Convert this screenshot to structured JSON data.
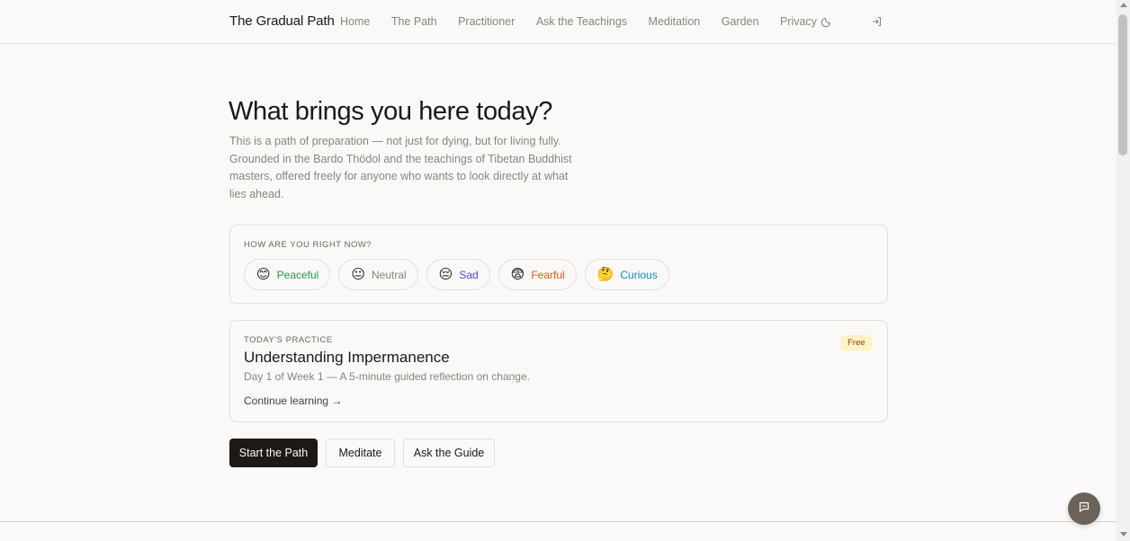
{
  "brand": "The Gradual Path",
  "nav": [
    "Home",
    "The Path",
    "Practitioner",
    "Ask the Teachings",
    "Meditation",
    "Garden",
    "Privacy"
  ],
  "icons": {
    "theme": "moon-icon",
    "login": "login-icon",
    "chat": "chat-icon"
  },
  "hero": {
    "title": "What brings you here today?",
    "subtitle": "This is a path of preparation — not just for dying, but for living fully. Grounded in the Bardo Thödol and the teachings of Tibetan Buddhist masters, offered freely for anyone who wants to look directly at what lies ahead."
  },
  "mood": {
    "label": "HOW ARE YOU RIGHT NOW?",
    "options": [
      {
        "emoji": "😊",
        "label": "Peaceful",
        "color": "#16a34a"
      },
      {
        "emoji": "😐",
        "label": "Neutral",
        "color": "#8a8580"
      },
      {
        "emoji": "😔",
        "label": "Sad",
        "color": "#4f46e5"
      },
      {
        "emoji": "😨",
        "label": "Fearful",
        "color": "#ea580c"
      },
      {
        "emoji": "🤔",
        "label": "Curious",
        "color": "#0891b2"
      }
    ]
  },
  "practice": {
    "label": "TODAY'S PRACTICE",
    "badge": "Free",
    "title": "Understanding Impermanence",
    "description": "Day 1 of Week 1 — A 5-minute guided reflection on change.",
    "link": "Continue learning →"
  },
  "actions": {
    "start": "Start the Path",
    "meditate": "Meditate",
    "guide": "Ask the Guide"
  },
  "colors": {
    "accent": "#1c1917",
    "background": "#faf9f7",
    "badge_bg": "#fef3c7"
  }
}
